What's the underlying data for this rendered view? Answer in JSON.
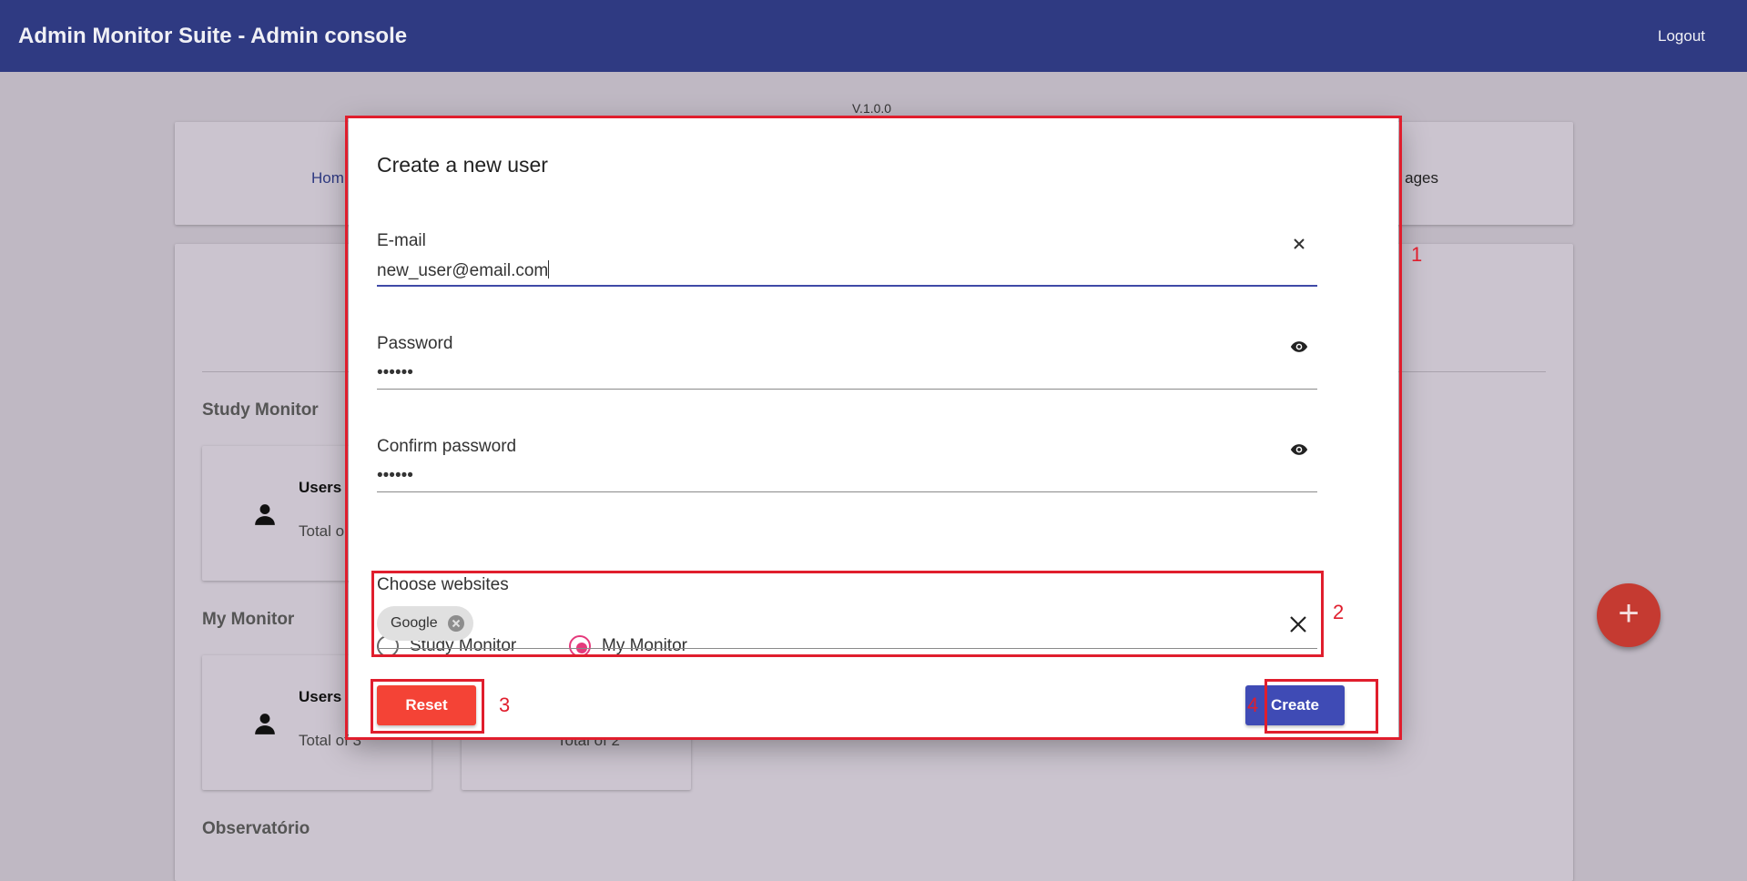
{
  "header": {
    "title": "Admin Monitor Suite - Admin console",
    "logout_label": "Logout"
  },
  "version": "V.1.0.0",
  "nav": {
    "home_label": "Hom",
    "pages_label": "ages"
  },
  "background": {
    "sections": [
      {
        "title": "Study Monitor",
        "card": {
          "title": "Users",
          "subtitle": "Total o"
        }
      },
      {
        "title": "My Monitor",
        "card": {
          "title": "Users",
          "subtitle": "Total of 3"
        },
        "card2": {
          "subtitle": "Total of 2"
        }
      },
      {
        "title": "Observatório"
      }
    ],
    "fab_label": "+"
  },
  "dialog": {
    "title": "Create a new user",
    "email": {
      "label": "E-mail",
      "value": "new_user@email.com",
      "clear_icon": "close-icon"
    },
    "password": {
      "label": "Password",
      "value": "••••••",
      "toggle_icon": "eye-icon"
    },
    "confirm_password": {
      "label": "Confirm password",
      "value": "••••••",
      "toggle_icon": "eye-icon"
    },
    "radio_options": [
      {
        "label": "Study Monitor",
        "checked": false
      },
      {
        "label": "My Monitor",
        "checked": true
      }
    ],
    "websites": {
      "label": "Choose websites",
      "chips": [
        "Google"
      ]
    },
    "reset_label": "Reset",
    "create_label": "Create"
  },
  "annotations": [
    "1",
    "2",
    "3",
    "4"
  ],
  "colors": {
    "header": "#2f3a82",
    "accent": "#3f4aa7",
    "radio": "#e53a7c",
    "reset": "#f44336",
    "create": "#3f4bb5",
    "highlight": "#e01e2d"
  }
}
